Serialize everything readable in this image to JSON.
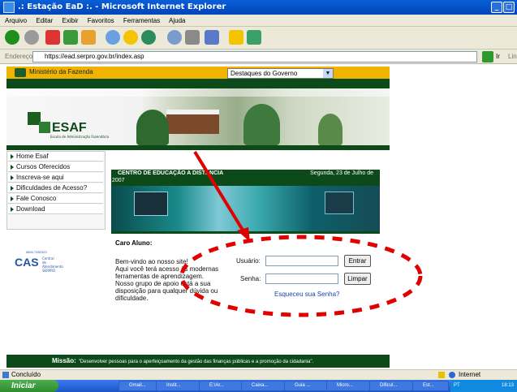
{
  "window": {
    "title": ".: Estação EaD :. - Microsoft Internet Explorer"
  },
  "menu": [
    "Arquivo",
    "Editar",
    "Exibir",
    "Favoritos",
    "Ferramentas",
    "Ajuda"
  ],
  "address": {
    "label": "Endereço",
    "url": "https://ead.serpro.gov.br/index.asp",
    "go_label": "Ir",
    "links_label": "Lin"
  },
  "page": {
    "ministerio": "Ministério da Fazenda",
    "destaques": "Destaques do Governo",
    "logo_text": "ESAF",
    "logo_subtitle": "Escola de Administração Fazendária",
    "nav": [
      "Home Esaf",
      "Cursos Oferecidos",
      "Inscreva-se aqui",
      "Dificuldades de Acesso?",
      "Fale Conosco",
      "Download"
    ],
    "cas_phone": "0800.7282323",
    "cas_logo": "CAS",
    "cas_sub": "Central de Atendimento SERPRO",
    "center_title": "CENTRO DE EDUCAÇÃO A DISTÂNCIA",
    "center_date": "Segunda, 23 de Julho de",
    "center_year": "2007",
    "greeting": "Caro Aluno:",
    "paragraph_lines": [
      "Bem-vindo ao nosso site!",
      "Aqui você terá acesso às modernas",
      "ferramentas de aprendizagem.",
      "Nosso grupo de apoio está a sua",
      "disposição para qualquer dúvida ou",
      "dificuldade."
    ],
    "login": {
      "user_label": "Usuário:",
      "pass_label": "Senha:",
      "enter": "Entrar",
      "clear": "Limpar",
      "forgot": "Esqueceu sua Senha?"
    },
    "mission_label": "Missão:",
    "mission_text": "\"Desenvolver pessoas para o aperfeiçoamento da gestão das finanças públicas e a promoção da cidadania\"."
  },
  "status": {
    "left": "Concluído",
    "zone": "Internet"
  },
  "taskbar": {
    "start": "Iniciar",
    "tasks": [
      "Gmail...",
      "Instit...",
      "E:\\Ar...",
      "Caixa...",
      "Guia ...",
      "Micro...",
      "Dificul...",
      "Est..."
    ],
    "lang": "PT",
    "clock": "18:13"
  },
  "colors": {
    "dark_green": "#0c4a1a",
    "gold": "#f0b400",
    "annotation_red": "#e00000"
  }
}
